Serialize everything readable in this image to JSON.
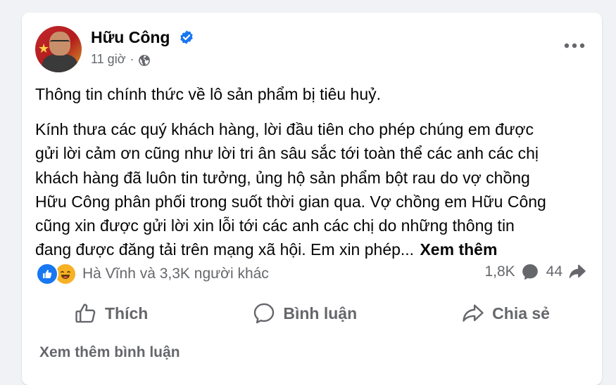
{
  "post": {
    "author": "Hữu Công",
    "time": "11 giờ",
    "separator": "·",
    "title": "Thông tin chính thức về lô sản phẩm bị tiêu huỷ.",
    "body_lines": [
      "Kính thưa các quý khách hàng, lời đầu tiên cho phép chúng em được",
      "gửi lời cảm ơn cũng như lời tri ân sâu sắc tới toàn thể các anh các chị",
      "khách hàng đã luôn tin tưởng, ủng hộ sản phẩm bột rau do vợ chồng",
      "Hữu Công phân phối trong suốt thời gian qua. Vợ chồng em Hữu Công",
      "cũng xin được gửi lời xin lỗi tới các anh các chị do những thông tin",
      "đang được đăng tải trên mạng xã hội. Em xin phép..."
    ],
    "see_more": "Xem thêm"
  },
  "reactions": {
    "summary": "Hà Vĩnh và 3,3K người khác",
    "comments_count": "1,8K",
    "shares_count": "44"
  },
  "actions": {
    "like": "Thích",
    "comment": "Bình luận",
    "share": "Chia sẻ"
  },
  "more_comments": "Xem thêm bình luận",
  "colors": {
    "page_bg": "#f0f2f5",
    "card_bg": "#ffffff",
    "text_primary": "#050505",
    "text_secondary": "#65676b",
    "accent_blue": "#1877f2",
    "haha_yellow": "#f7b125"
  },
  "icons": {
    "verified": "verified-badge-icon",
    "privacy": "globe-icon",
    "menu": "more-dots-icon",
    "like": "thumbs-up-icon",
    "comment": "speech-bubble-icon",
    "share": "share-arrow-icon"
  }
}
